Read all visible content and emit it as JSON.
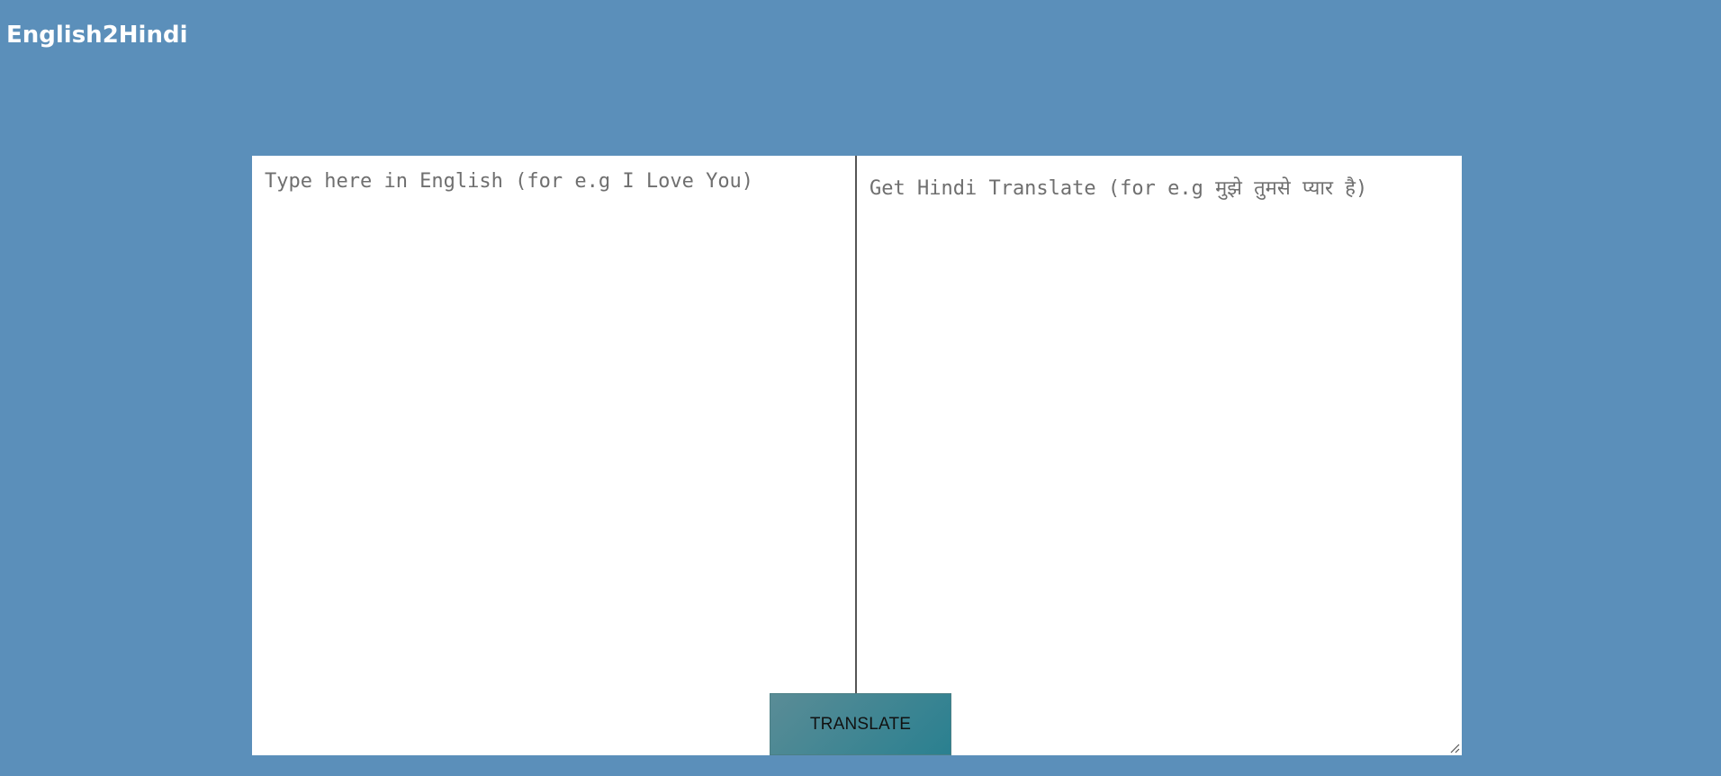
{
  "header": {
    "title": "English2Hindi"
  },
  "translator": {
    "english_input": {
      "value": "",
      "placeholder": "Type here in English (for e.g I Love You)"
    },
    "hindi_output": {
      "value": "",
      "placeholder": "Get Hindi Translate (for e.g मुझे तुमसे प्यार है)"
    },
    "translate_button_label": "TRANSLATE"
  },
  "colors": {
    "background": "#5b8fba",
    "panel": "#ffffff",
    "button_gradient_start": "#5a8c96",
    "button_gradient_end": "#2a8090"
  }
}
